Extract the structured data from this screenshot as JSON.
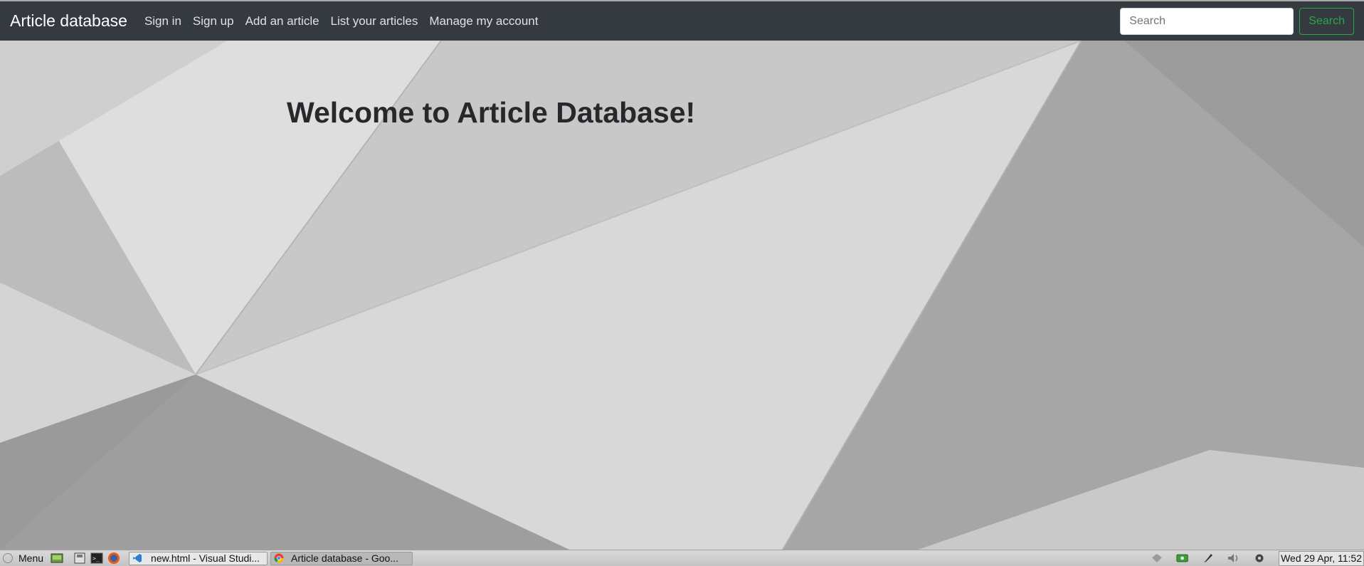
{
  "navbar": {
    "brand": "Article database",
    "links": [
      "Sign in",
      "Sign up",
      "Add an article",
      "List your articles",
      "Manage my account"
    ],
    "search_placeholder": "Search",
    "search_button": "Search"
  },
  "hero": {
    "title": "Welcome to Article Database!"
  },
  "colors": {
    "navbar_bg": "#343a40",
    "search_accent": "#28a745"
  },
  "taskbar": {
    "menu_label": "Menu",
    "launchers": [
      "desktop-icon",
      "files-icon",
      "terminal-icon",
      "firefox-icon"
    ],
    "windows": [
      {
        "label": "new.html - Visual Studi...",
        "icon": "vscode-icon",
        "active": false
      },
      {
        "label": "Article database - Goo...",
        "icon": "chrome-icon",
        "active": true
      }
    ],
    "tray_icons": [
      "network-icon",
      "battery-icon",
      "pen-icon",
      "volume-icon",
      "settings-icon"
    ],
    "clock": "Wed 29 Apr, 11:52"
  }
}
